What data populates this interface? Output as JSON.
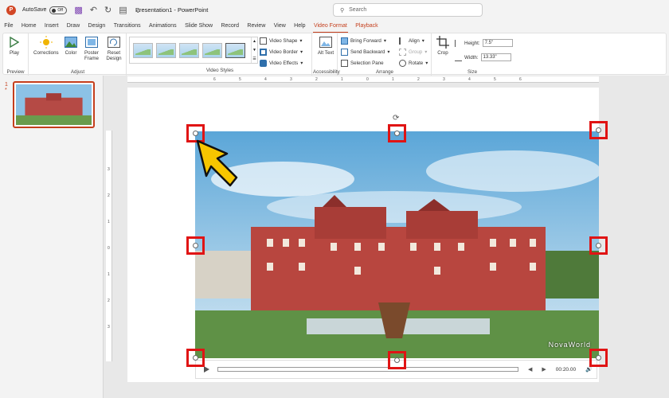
{
  "titlebar": {
    "autosave_label": "AutoSave",
    "autosave_state": "Off",
    "document_title": "Presentation1 - PowerPoint",
    "search_placeholder": "Search"
  },
  "tabs": [
    {
      "label": "File"
    },
    {
      "label": "Home"
    },
    {
      "label": "Insert"
    },
    {
      "label": "Draw"
    },
    {
      "label": "Design"
    },
    {
      "label": "Transitions"
    },
    {
      "label": "Animations"
    },
    {
      "label": "Slide Show"
    },
    {
      "label": "Record"
    },
    {
      "label": "Review"
    },
    {
      "label": "View"
    },
    {
      "label": "Help"
    },
    {
      "label": "Video Format"
    },
    {
      "label": "Playback"
    }
  ],
  "ribbon": {
    "preview": {
      "label": "Preview",
      "play": "Play"
    },
    "adjust": {
      "label": "Adjust",
      "corrections": "Corrections",
      "color": "Color",
      "poster_frame": "Poster Frame",
      "reset_design": "Reset Design"
    },
    "video_styles": {
      "label": "Video Styles",
      "shape": "Video Shape",
      "border": "Video Border",
      "effects": "Video Effects"
    },
    "accessibility": {
      "label": "Accessibility",
      "alt_text": "Alt Text"
    },
    "arrange": {
      "label": "Arrange",
      "bring_forward": "Bring Forward",
      "send_backward": "Send Backward",
      "selection_pane": "Selection Pane",
      "align": "Align",
      "group": "Group",
      "rotate": "Rotate"
    },
    "size": {
      "label": "Size",
      "crop": "Crop",
      "height_label": "Height:",
      "height_value": "7.5\"",
      "width_label": "Width:",
      "width_value": "13.33\""
    }
  },
  "slides": {
    "number": "1",
    "star": "*"
  },
  "ruler": {
    "horizontal": [
      "6",
      "5",
      "4",
      "3",
      "2",
      "1",
      "0",
      "1",
      "2",
      "3",
      "4",
      "5",
      "6"
    ],
    "vertical": [
      "3",
      "2",
      "1",
      "0",
      "1",
      "2",
      "3"
    ]
  },
  "video": {
    "watermark": "NovaWorld",
    "time": "00:20.00"
  },
  "colors": {
    "accent": "#c43e1c",
    "handle_highlight": "#e01414",
    "arrow_fill": "#f7c600"
  }
}
